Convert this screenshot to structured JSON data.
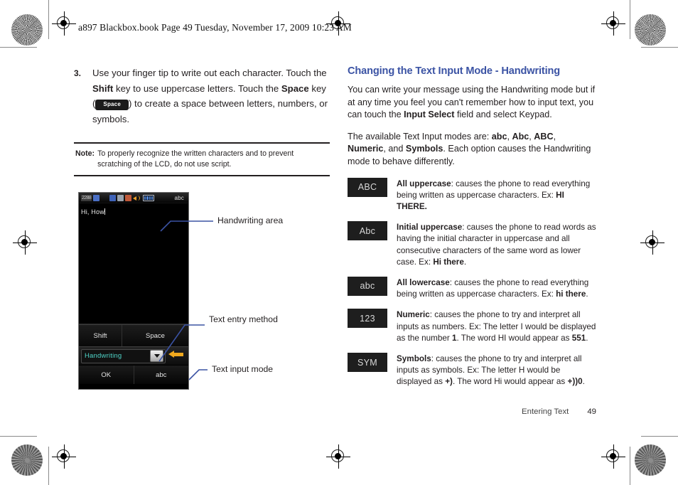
{
  "running_header": "a897 Blackbox.book  Page 49  Tuesday, November 17, 2009  10:23 AM",
  "left_column": {
    "step": {
      "number": "3.",
      "text_1": "Use your finger tip to write out each character. Touch the ",
      "bold_1": "Shift",
      "text_2": " key to use uppercase letters. Touch the ",
      "bold_2": "Space",
      "text_3": " key (",
      "key_label": "Space",
      "text_4": ") to create a space between letters, numbers, or symbols."
    },
    "note": {
      "label": "Note:",
      "text": "To properly recognize the written characters and to prevent scratching of the LCD, do not use script."
    },
    "phone": {
      "status": {
        "signal": "2288",
        "mode": "abc",
        "icons": [
          "sim-card-icon",
          "bluetooth-icon",
          "pc-sync-icon",
          "message-icon",
          "speaker-icon",
          "battery-icon"
        ]
      },
      "typed_text": "Hi, How",
      "keys": {
        "shift": "Shift",
        "space": "Space"
      },
      "input_select": "Handwriting",
      "soft_keys": {
        "left": "OK",
        "right": "abc"
      }
    },
    "callouts": [
      {
        "label": "Handwriting area"
      },
      {
        "label": "Text entry method"
      },
      {
        "label": "Text input mode"
      }
    ]
  },
  "right_column": {
    "heading": "Changing the Text Input Mode - Handwriting",
    "heading_color": "#3b53a4",
    "intro_1": "You can write your message using the Handwriting mode but if at any time you feel you can't remember how to input text, you can touch the ",
    "intro_bold": "Input Select",
    "intro_2": " field and select Keypad.",
    "modes_1": "The available Text Input modes are: ",
    "modes_b1": "abc",
    "modes_sep1": ", ",
    "modes_b2": "Abc",
    "modes_sep2": ", ",
    "modes_b3": "ABC",
    "modes_sep3": ", ",
    "modes_b4": "Numeric",
    "modes_sep4": ", and ",
    "modes_b5": "Symbols",
    "modes_2": ". Each option causes the Handwriting mode to behave differently.",
    "modes": [
      {
        "badge": "ABC",
        "title": "All uppercase",
        "body_1": ": causes the phone to read everything being written as uppercase characters. Ex: ",
        "example": "HI THERE.",
        "body_2": ""
      },
      {
        "badge": "Abc",
        "title": "Initial uppercase",
        "body_1": ": causes the phone to read words as having the initial character in uppercase and all consecutive characters of the same word as lower case. Ex: ",
        "example": "Hi there",
        "body_2": "."
      },
      {
        "badge": "abc",
        "title": "All lowercase",
        "body_1": ": causes the phone to read everything being written as uppercase characters. Ex: ",
        "example": "hi there",
        "body_2": "."
      },
      {
        "badge": "123",
        "title": "Numeric",
        "body_1": ": causes the phone to try and interpret all inputs as numbers. Ex: The letter I would be displayed as the number ",
        "example": "1",
        "body_2": ". The word HI would appear as ",
        "example_2": "551",
        "body_3": "."
      },
      {
        "badge": "SYM",
        "title": "Symbols",
        "body_1": ": causes the phone to try and interpret all inputs as symbols. Ex: The letter H would be displayed as ",
        "example": "+)",
        "body_2": ". The word Hi would appear as ",
        "example_2": "+))0",
        "body_3": "."
      }
    ]
  },
  "footer": {
    "section": "Entering Text",
    "page": "49"
  }
}
